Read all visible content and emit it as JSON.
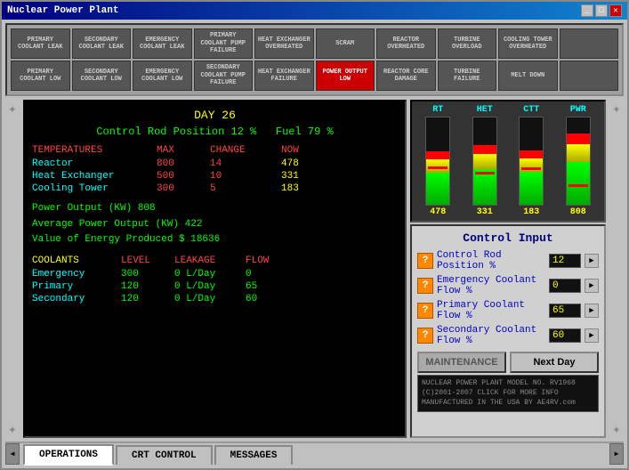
{
  "window": {
    "title": "Nuclear Power Plant"
  },
  "alarms": {
    "row1": [
      {
        "label": "PRIMARY COOLANT LEAK",
        "active": false
      },
      {
        "label": "SECONDARY COOLANT LEAK",
        "active": false
      },
      {
        "label": "EMERGENCY COOLANT LEAK",
        "active": false
      },
      {
        "label": "PRIMARY COOLANT PUMP FAILURE",
        "active": false
      },
      {
        "label": "HEAT EXCHANGER OVERHEATED",
        "active": false
      },
      {
        "label": "SCRAM",
        "active": false
      },
      {
        "label": "REACTOR OVERHEATED",
        "active": false
      },
      {
        "label": "TURBINE OVERLOAD",
        "active": false
      },
      {
        "label": "COOLING TOWER OVERHEATED",
        "active": false
      },
      {
        "label": "",
        "active": false
      }
    ],
    "row2": [
      {
        "label": "PRIMARY COOLANT LOW",
        "active": false
      },
      {
        "label": "SECONDARY COOLANT LOW",
        "active": false
      },
      {
        "label": "EMERGENCY COOLANT LOW",
        "active": false
      },
      {
        "label": "SECONDARY COOLANT PUMP FAILURE",
        "active": false
      },
      {
        "label": "HEAT EXCHANGER FAILURE",
        "active": false
      },
      {
        "label": "POWER OUTPUT LOW",
        "active": true
      },
      {
        "label": "REACTOR CORE DAMAGE",
        "active": false
      },
      {
        "label": "TURBINE FAILURE",
        "active": false
      },
      {
        "label": "MELT DOWN",
        "active": false
      },
      {
        "label": "",
        "active": false
      }
    ]
  },
  "display": {
    "day_label": "DAY 26",
    "rod_position_label": "Control Rod Position 12 %",
    "fuel_label": "Fuel 79 %",
    "temperatures_header": "TEMPERATURES",
    "max_header": "MAX",
    "change_header": "CHANGE",
    "now_header": "NOW",
    "temps": [
      {
        "name": "Reactor",
        "max": "800",
        "change": "14",
        "now": "478"
      },
      {
        "name": "Heat Exchanger",
        "max": "500",
        "change": "10",
        "now": "331"
      },
      {
        "name": "Cooling Tower",
        "max": "300",
        "change": "5",
        "now": "183"
      }
    ],
    "power_output": "Power Output          (KW) 808",
    "avg_power": "Average Power Output  (KW) 422",
    "energy_value": "Value of Energy Produced  $ 18636",
    "coolants_header": "COOLANTS",
    "level_header": "LEVEL",
    "leakage_header": "LEAKAGE",
    "flow_header": "FLOW",
    "coolants": [
      {
        "name": "Emergency",
        "level": "300",
        "leakage": "0 L/Day",
        "flow": "0"
      },
      {
        "name": "Primary",
        "level": "120",
        "leakage": "0 L/Day",
        "flow": "65"
      },
      {
        "name": "Secondary",
        "level": "120",
        "leakage": "0 L/Day",
        "flow": "60"
      }
    ]
  },
  "gauges": [
    {
      "label": "RT",
      "value": "478",
      "fill_pct": 60
    },
    {
      "label": "HET",
      "value": "331",
      "fill_pct": 66
    },
    {
      "label": "CTT",
      "value": "183",
      "fill_pct": 61
    },
    {
      "label": "PWR",
      "value": "808",
      "fill_pct": 80
    }
  ],
  "control": {
    "title": "Control Input",
    "rows": [
      {
        "label": "Control Rod Position %",
        "value": "12"
      },
      {
        "label": "Emergency Coolant Flow %",
        "value": "0"
      },
      {
        "label": "Primary Coolant Flow %",
        "value": "65"
      },
      {
        "label": "Secondary Coolant Flow %",
        "value": "60"
      }
    ],
    "maintenance_label": "MAINTENANCE",
    "next_day_label": "Next Day",
    "copyright": "(C)2001-2007  CLICK FOR MORE INFO\nMANUFACTURED IN THE USA BY AE4RV.com",
    "model": "NUCLEAR POWER PLANT  MODEL NO. RV1968"
  },
  "tabs": [
    {
      "label": "OPERATIONS",
      "active": true
    },
    {
      "label": "CRT CONTROL",
      "active": false
    },
    {
      "label": "MESSAGES",
      "active": false
    }
  ]
}
